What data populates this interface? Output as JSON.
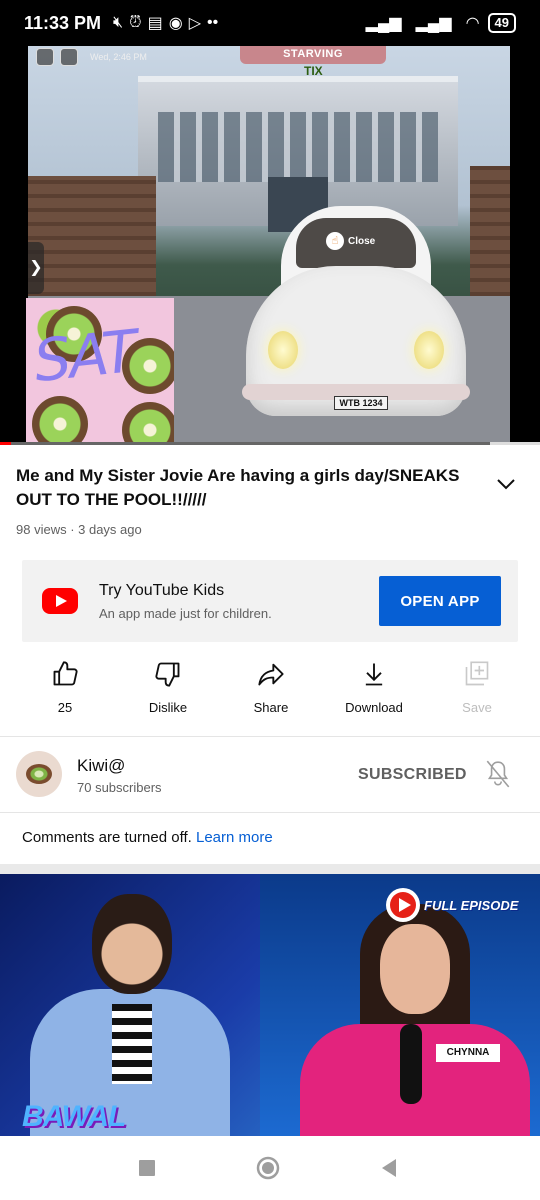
{
  "status_bar": {
    "time": "11:33 PM",
    "battery": "49"
  },
  "player": {
    "hud_date": "Wed, 2:46 PM",
    "hud_status": "STARVING",
    "tix_label": "TIX",
    "close_label": "Close",
    "plate": "WTB 1234",
    "overlay_text": "SAT",
    "progress_fraction": 0.02
  },
  "video": {
    "title": "Me and My Sister Jovie Are having a girls day/SNEAKS OUT TO THE POOL!!/////",
    "meta": "98 views · 3 days ago"
  },
  "kids_banner": {
    "title": "Try YouTube Kids",
    "subtitle": "An app made just for children.",
    "button": "OPEN APP"
  },
  "actions": {
    "like": "25",
    "dislike": "Dislike",
    "share": "Share",
    "download": "Download",
    "save": "Save"
  },
  "channel": {
    "name": "Kiwi@",
    "subscribers": "70 subscribers",
    "subscribe_state": "SUBSCRIBED"
  },
  "comments": {
    "text": "Comments are turned off.",
    "link": "Learn more"
  },
  "next_video": {
    "badge": "FULL EPISODE",
    "nametag": "CHYNNA",
    "show_logo": "BAWAL"
  },
  "colors": {
    "accent_blue": "#065fd4",
    "youtube_red": "#ff0000"
  }
}
